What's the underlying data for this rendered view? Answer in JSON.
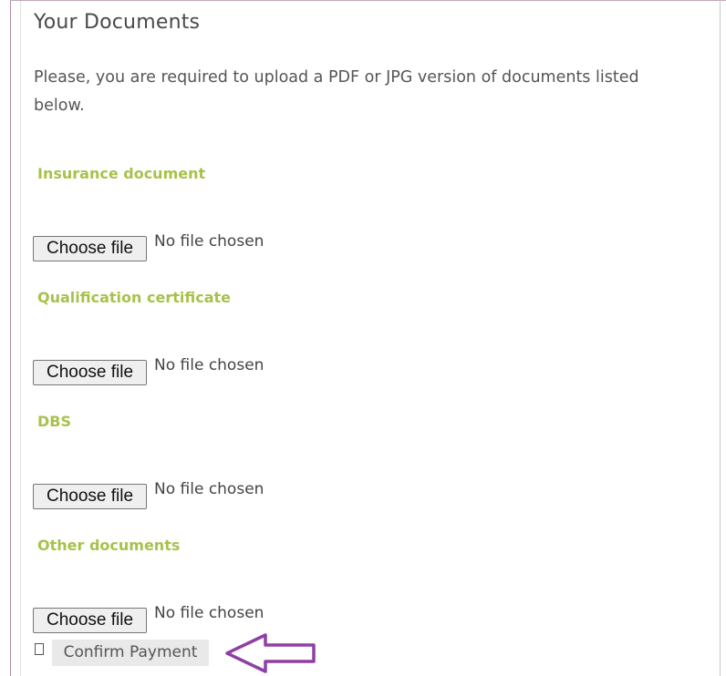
{
  "section": {
    "title": "Your Documents",
    "intro": "Please, you are required to upload a PDF or JPG version of documents listed below."
  },
  "documents": [
    {
      "label": "Insurance document",
      "button_label": "Choose file",
      "status": "No file chosen"
    },
    {
      "label": "Qualification certificate",
      "button_label": "Choose file",
      "status": "No file chosen"
    },
    {
      "label": "DBS",
      "button_label": "Choose file",
      "status": "No file chosen"
    },
    {
      "label": "Other documents",
      "button_label": "Choose file",
      "status": "No file chosen"
    }
  ],
  "confirm": {
    "checked": false,
    "button_label": "Confirm Payment"
  },
  "annotation": {
    "icon": "left-arrow-icon",
    "color": "#8e3fa6"
  },
  "colors": {
    "label_green": "#a7c24b",
    "frame_border": "#b08aa0"
  }
}
